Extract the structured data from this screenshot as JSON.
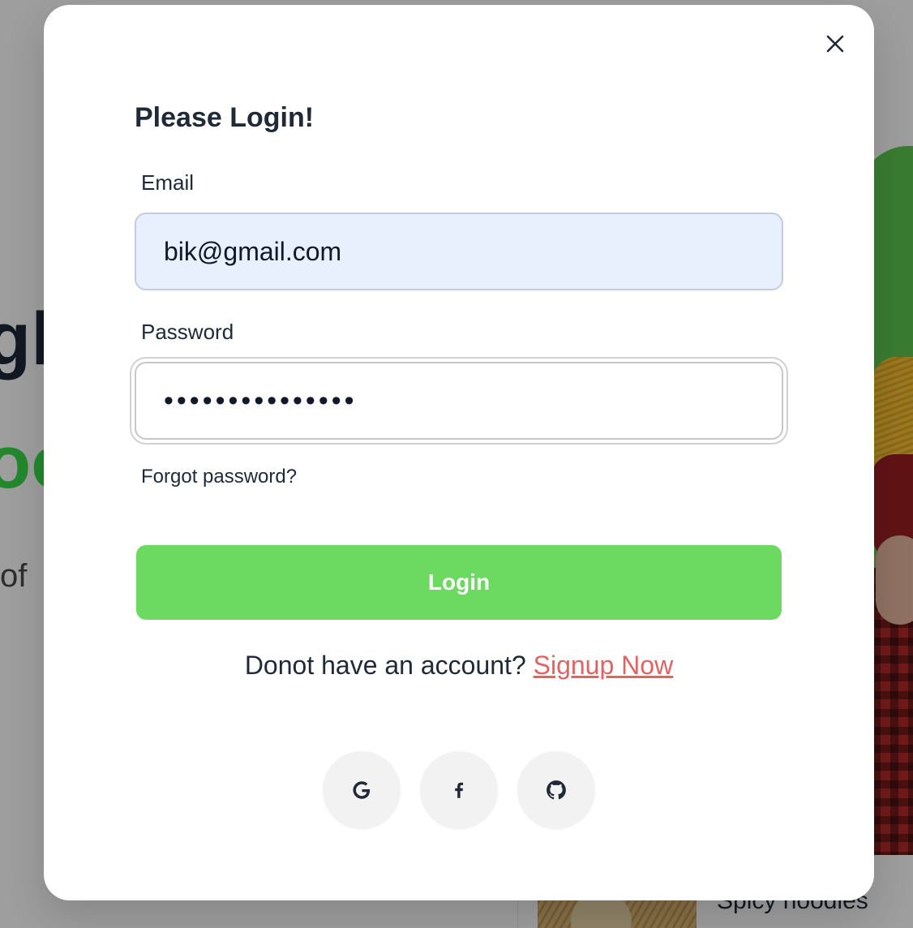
{
  "background": {
    "hero_line_1": "gh",
    "hero_line_2": "oo",
    "hero_text": "of",
    "card_title": "Spicy noodles"
  },
  "modal": {
    "title": "Please Login!",
    "email_label": "Email",
    "email_value": "bik@gmail.com",
    "password_label": "Password",
    "password_masked": "•••••••••••••••",
    "forgot_password": "Forgot password?",
    "login_button": "Login",
    "signup_prompt": "Donot have an account? ",
    "signup_link": "Signup Now",
    "social_buttons": [
      "google-icon",
      "facebook-icon",
      "github-icon"
    ]
  },
  "colors": {
    "accent_green": "#6cd960",
    "signup_link": "#e06464",
    "email_autofill": "#e8f0fe"
  }
}
